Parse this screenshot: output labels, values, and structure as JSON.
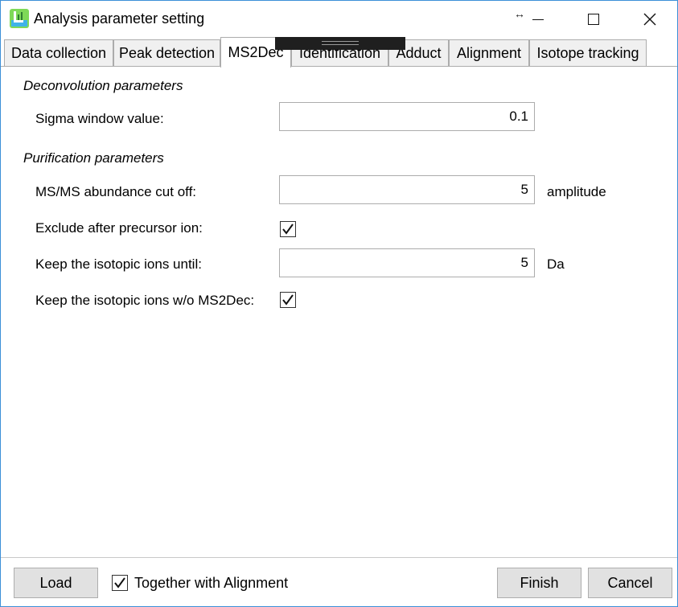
{
  "window": {
    "title": "Analysis parameter setting",
    "resize_glyph": "↔",
    "close_glyph": "✕"
  },
  "tabs": [
    {
      "label": "Data collection",
      "active": false
    },
    {
      "label": "Peak detection",
      "active": false
    },
    {
      "label": "MS2Dec",
      "active": true
    },
    {
      "label": "Identification",
      "active": false
    },
    {
      "label": "Adduct",
      "active": false
    },
    {
      "label": "Alignment",
      "active": false
    },
    {
      "label": "Isotope tracking",
      "active": false
    }
  ],
  "deconvolution": {
    "section_title": "Deconvolution parameters",
    "sigma_label": "Sigma window value:",
    "sigma_value": "0.1"
  },
  "purification": {
    "section_title": "Purification parameters",
    "abundance_label": "MS/MS abundance cut off:",
    "abundance_value": "5",
    "abundance_unit": "amplitude",
    "exclude_label": "Exclude after precursor ion:",
    "exclude_checked": true,
    "isotopic_label": "Keep the isotopic ions until:",
    "isotopic_value": "5",
    "isotopic_unit": "Da",
    "isotopic_wo_label": "Keep the isotopic ions w/o MS2Dec:",
    "isotopic_wo_checked": true
  },
  "footer": {
    "load_label": "Load",
    "together_label": "Together with Alignment",
    "together_checked": true,
    "finish_label": "Finish",
    "cancel_label": "Cancel"
  },
  "icons": {
    "app": "app-icon",
    "resize": "resize-arrow-icon",
    "minimize": "minimize-icon",
    "maximize": "maximize-icon",
    "close": "close-icon",
    "check": "checkmark-icon"
  },
  "colors": {
    "window_border": "#3c8fd8",
    "tab_inactive": "#f0f0f0",
    "button_bg": "#e1e1e1",
    "control_border": "#acacac"
  }
}
